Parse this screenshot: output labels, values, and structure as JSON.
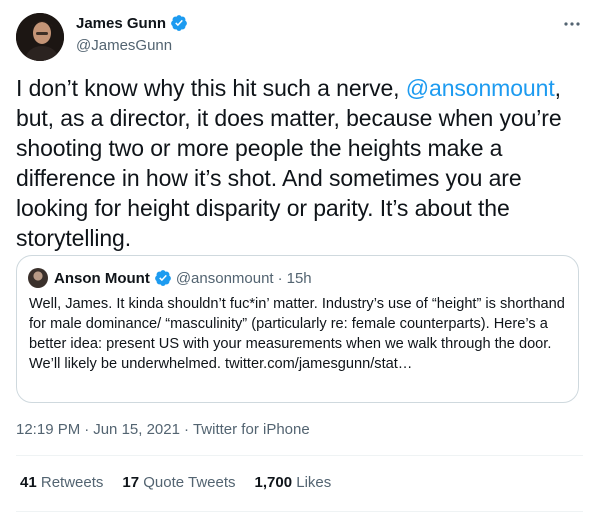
{
  "author": {
    "name": "James Gunn",
    "handle": "@JamesGunn"
  },
  "tweet": {
    "text_before": "I don’t know why this hit such a nerve, ",
    "mention": "@ansonmount",
    "text_after": ", but, as a director, it does matter, because when you’re shooting two or more people the heights make a difference in how it’s shot. And sometimes you are looking for height disparity or parity. It’s about the storytelling."
  },
  "quote": {
    "name": "Anson Mount",
    "handle": "@ansonmount",
    "separator": "·",
    "time": "15h",
    "text": "Well, James. It kinda shouldn’t fuc*in’ matter. Industry’s use of “height” is shorthand for male dominance/ “masculinity” (particularly re: female counterparts). Here’s a better idea: present US with your measurements when we walk through the door. We’ll likely be underwhelmed. twitter.com/jamesgunn/stat…"
  },
  "meta": {
    "time": "12:19 PM",
    "separator1": "·",
    "date": "Jun 15, 2021",
    "separator2": "·",
    "source": "Twitter for iPhone"
  },
  "stats": {
    "retweets_count": "41",
    "retweets_label": "Retweets",
    "quotes_count": "17",
    "quotes_label": "Quote Tweets",
    "likes_count": "1,700",
    "likes_label": "Likes"
  },
  "icons": {
    "verified": "verified-badge-icon",
    "more": "more-options-icon"
  },
  "colors": {
    "accent": "#1d9bf0",
    "text": "#0f1419",
    "secondary": "#536471",
    "border": "#cfd9de"
  }
}
